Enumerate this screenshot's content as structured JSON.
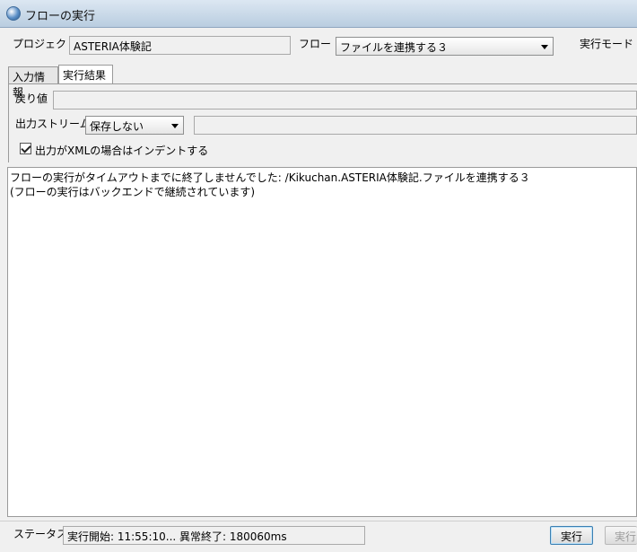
{
  "window": {
    "title": "フローの実行",
    "icon": "app-globe-icon"
  },
  "header": {
    "project_label": "プロジェクト",
    "project_value": "ASTERIA体験記",
    "flow_label": "フロー",
    "flow_selected": "ファイルを連携する３",
    "mode_label": "実行モード"
  },
  "tabs": [
    {
      "label": "入力情報",
      "active": false
    },
    {
      "label": "実行結果",
      "active": true
    }
  ],
  "result": {
    "return_label": "戻り値",
    "return_value": "",
    "stream_label": "出力ストリーム",
    "stream_selected": "保存しない",
    "stream_path": "",
    "indent_checkbox_label": "出力がXMLの場合はインデントする",
    "indent_checked": true
  },
  "output": {
    "lines": [
      "フローの実行がタイムアウトまでに終了しませんでした: /Kikuchan.ASTERIA体験記.ファイルを連携する３",
      "(フローの実行はバックエンドで継続されています)"
    ]
  },
  "status": {
    "label": "ステータス",
    "value": "実行開始: 11:55:10... 異常終了: 180060ms"
  },
  "buttons": {
    "run": "実行",
    "run2": "実行"
  }
}
